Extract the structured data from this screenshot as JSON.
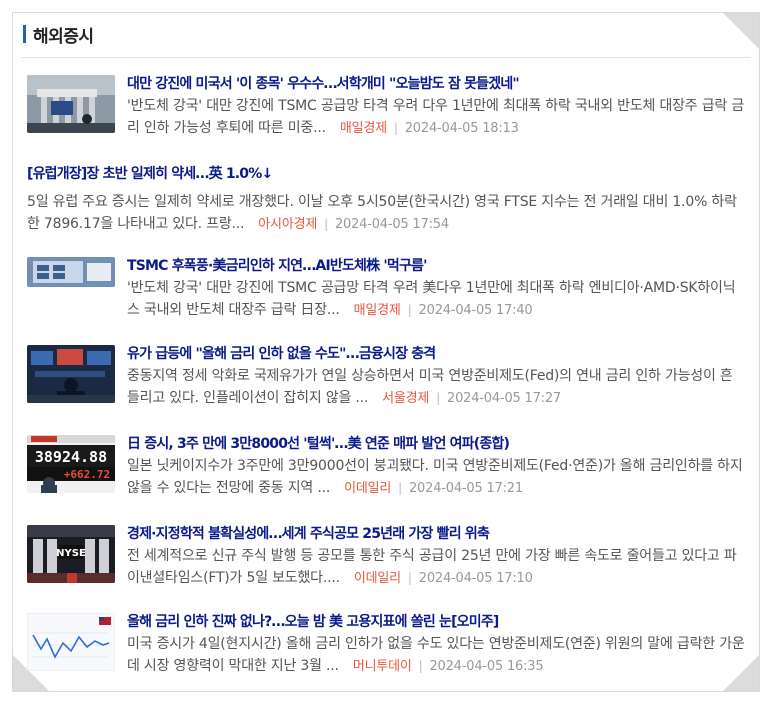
{
  "section": {
    "title": "해외증시"
  },
  "articles": [
    {
      "headline": "대만 강진에 미국서 '이 종목' 우수수…서학개미 \"오늘밤도 잠 못들겠네\"",
      "summary": "'반도체 강국' 대만 강진에 TSMC 공급망 타격 우려 다우 1년만에 최대폭 하락 국내외 반도체 대장주 급락 금리 인하 가능성 후퇴에 따른 미중...",
      "source": "매일경제",
      "date": "2024-04-05 18:13",
      "thumb": "stock-exchange-building-photo"
    },
    {
      "headline": "[유럽개장]장 초반 일제히 약세…英 1.0%↓",
      "summary": "5일 유럽 주요 증시는 일제히 약세로 개장했다. 이날 오후 5시50분(한국시간) 영국 FTSE 지수는 전 거래일 대비 1.0% 하락한 7896.17을 나타내고 있다. 프랑...",
      "source": "아시아경제",
      "date": "2024-04-05 17:54"
    },
    {
      "headline": "TSMC 후폭풍·美금리인하 지연…AI반도체株 '먹구름'",
      "summary": "'반도체 강국' 대만 강진에 TSMC 공급망 타격 우려 美다우 1년만에 최대폭 하락 엔비디아·AMD·SK하이닉스 국내외 반도체 대장주 급락 日장...",
      "source": "매일경제",
      "date": "2024-04-05 17:40",
      "thumb": "semiconductor-wafer-photo"
    },
    {
      "headline": "유가 급등에 \"올해 금리 인하 없을 수도\"…금융시장 충격",
      "summary": "중동지역 정세 악화로 국제유가가 연일 상승하면서 미국 연방준비제도(Fed)의 연내 금리 인하 가능성이 흔들리고 있다. 인플레이션이 잡히지 않을 ...",
      "source": "서울경제",
      "date": "2024-04-05 17:27",
      "thumb": "trading-floor-photo"
    },
    {
      "headline": "日 증시, 3주 만에 3만8000선 '털썩'…美 연준 매파 발언 여파(종합)",
      "summary": "일본 닛케이지수가 3주만에 3만9000선이 붕괴됐다. 미국 연방준비제도(Fed·연준)가 올해 금리인하를 하지 않을 수 있다는 전망에 중동 지역 ...",
      "source": "이데일리",
      "date": "2024-04-05 17:21",
      "thumb": "stock-board-photo",
      "thumb_text": [
        "38924.88",
        "+662.72"
      ]
    },
    {
      "headline": "경제·지정학적 불확실성에…세계 주식공모 25년래 가장 빨리 위축",
      "summary": "전 세계적으로 신규 주식 발행 등 공모를 통한 주식 공급이 25년 만에 가장 빠른 속도로 줄어들고 있다고 파이낸셜타임스(FT)가 5일 보도했다....",
      "source": "이데일리",
      "date": "2024-04-05 17:10",
      "thumb": "nyse-photo",
      "thumb_text": [
        "NYSE"
      ]
    },
    {
      "headline": "올해 금리 인하 진짜 없나?…오늘 밤 美 고용지표에 쏠린 눈[오미주]",
      "summary": "미국 증시가 4일(현지시간) 올해 금리 인하가 없을 수도 있다는 연방준비제도(연준) 위원의 말에 급락한 가운데 시장 영향력이 막대한 지난 3월 ...",
      "source": "머니투데이",
      "date": "2024-04-05 16:35",
      "thumb": "line-chart-photo"
    }
  ],
  "colors": {
    "headline": "#0a1a8a",
    "source": "#e5593f",
    "accent": "#1f5fbf"
  }
}
